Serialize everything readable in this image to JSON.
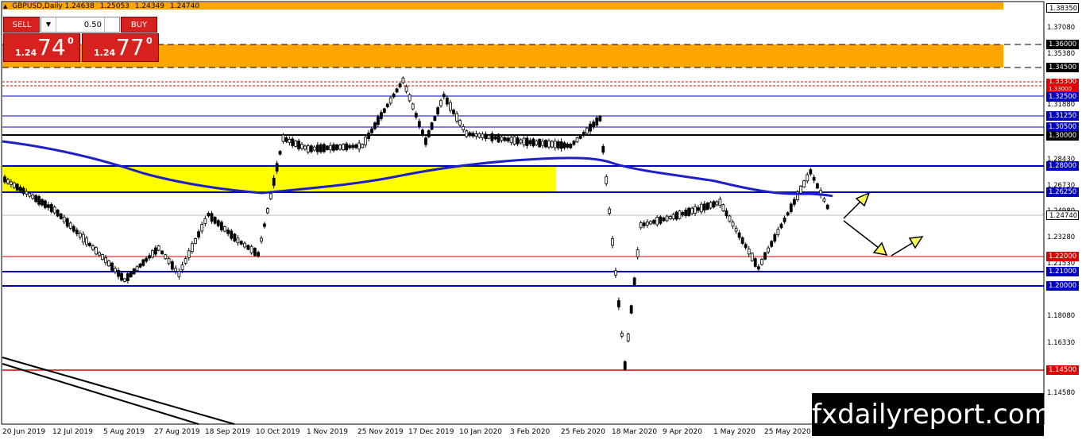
{
  "title": {
    "symbol": "GBPUSD,Daily",
    "ohlc": [
      "1.24638",
      "1.25053",
      "1.24349",
      "1.24740"
    ]
  },
  "trade_panel": {
    "sell_label": "SELL",
    "buy_label": "BUY",
    "lot_value": "0.50",
    "sell_small": "1.24",
    "sell_big": "74",
    "sell_sup": "0",
    "buy_small": "1.24",
    "buy_big": "77",
    "buy_sup": "0"
  },
  "price_axis": {
    "ticks": [
      "1.38350",
      "1.37080",
      "1.35380",
      "1.34500",
      "1.33000",
      "1.31880",
      "1.30180",
      "1.28430",
      "1.26730",
      "1.24980",
      "1.23280",
      "1.21530",
      "1.19780",
      "1.18080",
      "1.16330",
      "1.14580"
    ],
    "tags": [
      {
        "text": "1.38350",
        "style": "current"
      },
      {
        "text": "1.36000",
        "style": "black"
      },
      {
        "text": "1.34500",
        "style": "black"
      },
      {
        "text": "1.33300",
        "style": "red"
      },
      {
        "text": "1.33000",
        "style": "red"
      },
      {
        "text": "1.32500",
        "style": "blue"
      },
      {
        "text": "1.31250",
        "style": "blue"
      },
      {
        "text": "1.30500",
        "style": "blue"
      },
      {
        "text": "1.30000",
        "style": "black"
      },
      {
        "text": "1.28000",
        "style": "blue"
      },
      {
        "text": "1.26250",
        "style": "blue"
      },
      {
        "text": "1.24740",
        "style": "current"
      },
      {
        "text": "1.22000",
        "style": "red"
      },
      {
        "text": "1.21000",
        "style": "blue"
      },
      {
        "text": "1.20000",
        "style": "blue"
      },
      {
        "text": "1.14500",
        "style": "red"
      }
    ]
  },
  "date_axis": [
    "20 Jun 2019",
    "12 Jul 2019",
    "5 Aug 2019",
    "27 Aug 2019",
    "18 Sep 2019",
    "10 Oct 2019",
    "1 Nov 2019",
    "25 Nov 2019",
    "17 Dec 2019",
    "10 Jan 2020",
    "3 Feb 2020",
    "25 Feb 2020",
    "18 Mar 2020",
    "9 Apr 2020",
    "1 May 2020",
    "25 May 2020"
  ],
  "brand": "fxdailyreport.com",
  "colors": {
    "resistance_zone": "#ffa500",
    "support_zone": "#ffff00",
    "ma_line": "#1f1fc8",
    "level_blue": "#0000c0",
    "level_red": "#e00000",
    "level_black": "#000000",
    "arrow": "#ffff55",
    "sell_button": "#d6211f"
  },
  "chart_data": {
    "type": "candlestick",
    "symbol": "GBPUSD",
    "timeframe": "Daily",
    "last_close": 1.2474,
    "horizontal_levels": [
      1.36,
      1.345,
      1.333,
      1.33,
      1.325,
      1.3125,
      1.305,
      1.3,
      1.28,
      1.2625,
      1.22,
      1.21,
      1.2,
      1.145
    ],
    "zones": [
      {
        "from": 1.345,
        "to": 1.36,
        "color": "orange"
      },
      {
        "from": 1.2625,
        "to": 1.28,
        "color": "yellow"
      }
    ],
    "ma_line_points": [
      {
        "date": "2019-06-20",
        "price": 1.2965
      },
      {
        "date": "2019-08-05",
        "price": 1.284
      },
      {
        "date": "2019-09-18",
        "price": 1.266
      },
      {
        "date": "2019-10-10",
        "price": 1.262
      },
      {
        "date": "2019-11-25",
        "price": 1.27
      },
      {
        "date": "2019-12-17",
        "price": 1.277
      },
      {
        "date": "2020-02-03",
        "price": 1.284
      },
      {
        "date": "2020-02-25",
        "price": 1.2855
      },
      {
        "date": "2020-03-18",
        "price": 1.278
      },
      {
        "date": "2020-04-09",
        "price": 1.272
      },
      {
        "date": "2020-05-25",
        "price": 1.262
      },
      {
        "date": "2020-06-08",
        "price": 1.261
      }
    ],
    "close_path": [
      {
        "date": "2019-06-20",
        "price": 1.27
      },
      {
        "date": "2019-07-12",
        "price": 1.25
      },
      {
        "date": "2019-08-05",
        "price": 1.215
      },
      {
        "date": "2019-08-12",
        "price": 1.204
      },
      {
        "date": "2019-08-27",
        "price": 1.225
      },
      {
        "date": "2019-09-05",
        "price": 1.208
      },
      {
        "date": "2019-09-18",
        "price": 1.247
      },
      {
        "date": "2019-10-01",
        "price": 1.23
      },
      {
        "date": "2019-10-10",
        "price": 1.221
      },
      {
        "date": "2019-10-21",
        "price": 1.297
      },
      {
        "date": "2019-11-01",
        "price": 1.29
      },
      {
        "date": "2019-11-25",
        "price": 1.292
      },
      {
        "date": "2019-12-13",
        "price": 1.335
      },
      {
        "date": "2019-12-23",
        "price": 1.295
      },
      {
        "date": "2019-12-31",
        "price": 1.325
      },
      {
        "date": "2020-01-10",
        "price": 1.3
      },
      {
        "date": "2020-02-03",
        "price": 1.295
      },
      {
        "date": "2020-02-25",
        "price": 1.292
      },
      {
        "date": "2020-03-09",
        "price": 1.31
      },
      {
        "date": "2020-03-20",
        "price": 1.148
      },
      {
        "date": "2020-03-27",
        "price": 1.24
      },
      {
        "date": "2020-04-09",
        "price": 1.245
      },
      {
        "date": "2020-05-01",
        "price": 1.255
      },
      {
        "date": "2020-05-18",
        "price": 1.212
      },
      {
        "date": "2020-06-10",
        "price": 1.275
      },
      {
        "date": "2020-06-19",
        "price": 1.2474
      }
    ]
  }
}
